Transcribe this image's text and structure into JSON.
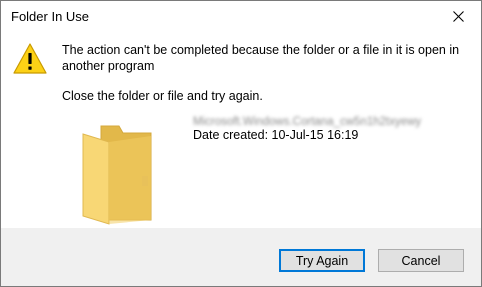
{
  "window": {
    "title": "Folder In Use"
  },
  "dialog": {
    "message": "The action can't be completed because the folder or a file in it is open in another program",
    "hint": "Close the folder or file and try again.",
    "file_name_obscured": "Microsoft.Windows.Cortana_cw5n1h2txyewy",
    "date_created": "Date created: 10-Jul-15 16:19"
  },
  "buttons": {
    "try_again": "Try Again",
    "cancel": "Cancel"
  },
  "icons": {
    "warning": "warning-triangle-icon",
    "folder": "folder-icon",
    "close": "close-icon"
  },
  "colors": {
    "warning_fill": "#fcd116",
    "folder_fill": "#f8d775",
    "default_button_border": "#0078d7",
    "footer_bg": "#f0f0f0"
  }
}
